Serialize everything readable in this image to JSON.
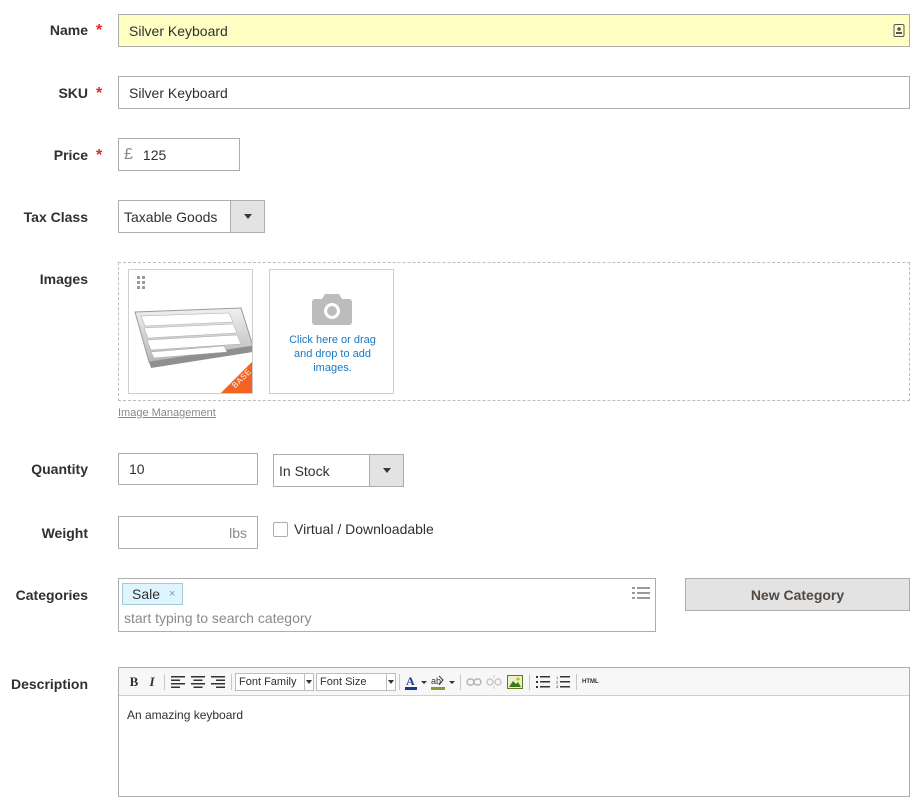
{
  "fields": {
    "name": {
      "label": "Name",
      "value": "Silver Keyboard"
    },
    "sku": {
      "label": "SKU",
      "value": "Silver Keyboard"
    },
    "price": {
      "label": "Price",
      "currency": "£",
      "value": "125"
    },
    "tax_class": {
      "label": "Tax Class",
      "value": "Taxable Goods"
    },
    "images": {
      "label": "Images",
      "base_badge": "BASE",
      "upload_text": "Click here or drag and drop to add images.",
      "management_link": "Image Management"
    },
    "quantity": {
      "label": "Quantity",
      "value": "10",
      "stock_status": "In Stock"
    },
    "weight": {
      "label": "Weight",
      "unit": "lbs",
      "value": "",
      "virtual_label": "Virtual / Downloadable"
    },
    "categories": {
      "label": "Categories",
      "tags": [
        "Sale"
      ],
      "placeholder": "start typing to search category",
      "new_button": "New Category"
    },
    "description": {
      "label": "Description",
      "font_family": "Font Family",
      "font_size": "Font Size",
      "html_label": "HTML",
      "content": "An amazing keyboard"
    }
  },
  "required_marker": "*",
  "colors": {
    "accent_required": "#e22626",
    "highlight_input": "#ffffc4",
    "link": "#1979c3",
    "tag_bg": "#def5ff",
    "base_badge": "#f26322"
  }
}
